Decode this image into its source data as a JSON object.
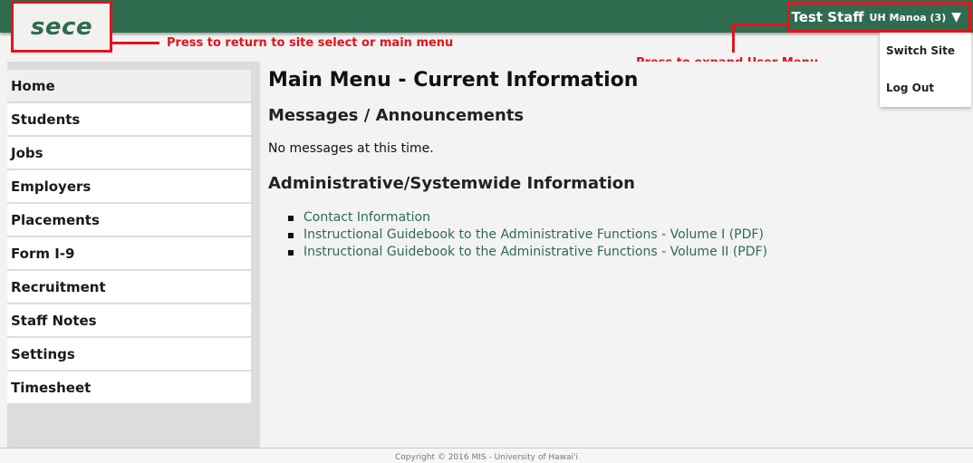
{
  "header": {
    "logo_text": "sece",
    "user_name": "Test Staff",
    "user_site": "UH Manoa (3)",
    "caret_icon": "caret-down-icon",
    "bar_color": "#2e6b4f"
  },
  "user_menu": {
    "items": [
      {
        "label": "Switch Site"
      },
      {
        "label": "Log Out"
      }
    ]
  },
  "annotations": {
    "logo_note": "Press to return to site select or main menu",
    "user_note": "Press to expand User Menu",
    "color": "#e4131c"
  },
  "sidebar": {
    "items": [
      {
        "label": "Home"
      },
      {
        "label": "Students"
      },
      {
        "label": "Jobs"
      },
      {
        "label": "Employers"
      },
      {
        "label": "Placements"
      },
      {
        "label": "Form I-9"
      },
      {
        "label": "Recruitment"
      },
      {
        "label": "Staff Notes"
      },
      {
        "label": "Settings"
      },
      {
        "label": "Timesheet"
      }
    ]
  },
  "main": {
    "title": "Main Menu - Current Information",
    "messages_heading": "Messages / Announcements",
    "messages_text": "No messages at this time.",
    "admin_heading": "Administrative/Systemwide Information",
    "links": [
      {
        "label": "Contact Information"
      },
      {
        "label": "Instructional Guidebook to the Administrative Functions - Volume I (PDF)"
      },
      {
        "label": "Instructional Guidebook to the Administrative Functions - Volume II (PDF)"
      }
    ]
  },
  "footer": {
    "copyright": "Copyright © 2016 MIS - University of Hawai'i"
  }
}
